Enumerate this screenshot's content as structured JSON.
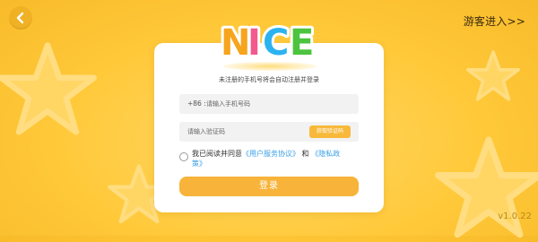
{
  "header": {
    "guest_link": "游客进入>>"
  },
  "logo": {
    "text": "NICE",
    "letters": [
      "N",
      "I",
      "C",
      "E"
    ],
    "letter_colors": [
      "#f7a41e",
      "#f25a8e",
      "#2cb3ef",
      "#4cc43f"
    ]
  },
  "card": {
    "subtitle": "未注册的手机号将会自动注册并登录"
  },
  "phone": {
    "prefix": "+86 :",
    "placeholder": "请输入手机号码"
  },
  "code": {
    "placeholder": "请输入验证码",
    "get_code_label": "获取验证码"
  },
  "agreement": {
    "prefix": "我已阅读并同意",
    "user_agreement": "《用户服务协议》",
    "and": "和",
    "privacy_policy": "《隐私政策》"
  },
  "login_label": "登录",
  "version": "v1.0.22",
  "colors": {
    "background": "#ffc93a",
    "accent": "#f8b33a",
    "link": "#3aa0e6"
  }
}
